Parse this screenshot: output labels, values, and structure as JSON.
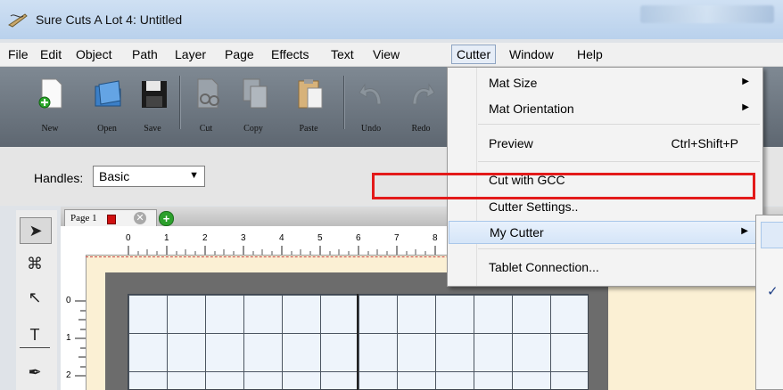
{
  "window": {
    "title": "Sure Cuts A Lot 4: Untitled"
  },
  "menubar": {
    "items": [
      "File",
      "Edit",
      "Object",
      "Path",
      "Layer",
      "Page",
      "Effects",
      "Text",
      "View",
      "Cutter",
      "Window",
      "Help"
    ],
    "active": "Cutter"
  },
  "toolbar": {
    "buttons": [
      {
        "label": "New",
        "icon": "new-document-icon"
      },
      {
        "label": "Open",
        "icon": "open-folder-icon"
      },
      {
        "label": "Save",
        "icon": "save-disk-icon"
      },
      {
        "label": "Cut",
        "icon": "scissors-icon"
      },
      {
        "label": "Copy",
        "icon": "copy-icon"
      },
      {
        "label": "Paste",
        "icon": "paste-icon"
      },
      {
        "label": "Undo",
        "icon": "undo-icon"
      },
      {
        "label": "Redo",
        "icon": "redo-icon"
      }
    ]
  },
  "handles": {
    "label": "Handles:",
    "value": "Basic"
  },
  "page_tab": {
    "label": "Page 1"
  },
  "ruler": {
    "ticks": [
      "0",
      "1",
      "2",
      "3",
      "4",
      "5",
      "6",
      "7",
      "8"
    ],
    "vticks": [
      "0",
      "1",
      "2"
    ]
  },
  "cutter_menu": {
    "items": [
      {
        "label": "Mat Size",
        "shortcut": "",
        "submenu": true
      },
      {
        "label": "Mat Orientation",
        "shortcut": "",
        "submenu": true
      },
      {
        "label": "Preview",
        "shortcut": "Ctrl+Shift+P",
        "submenu": false
      },
      {
        "label": "Cut with GCC",
        "shortcut": "",
        "submenu": false
      },
      {
        "label": "Cutter Settings..",
        "shortcut": "",
        "submenu": false
      },
      {
        "label": "My Cutter",
        "shortcut": "",
        "submenu": true
      },
      {
        "label": "Tablet Connection...",
        "shortcut": "",
        "submenu": false
      }
    ]
  },
  "submenu": {
    "check": "✓"
  },
  "colors": {
    "highlight_box": "#e31a1a",
    "toolbar": "#6b747e",
    "canvas": "#fbf0d4"
  }
}
